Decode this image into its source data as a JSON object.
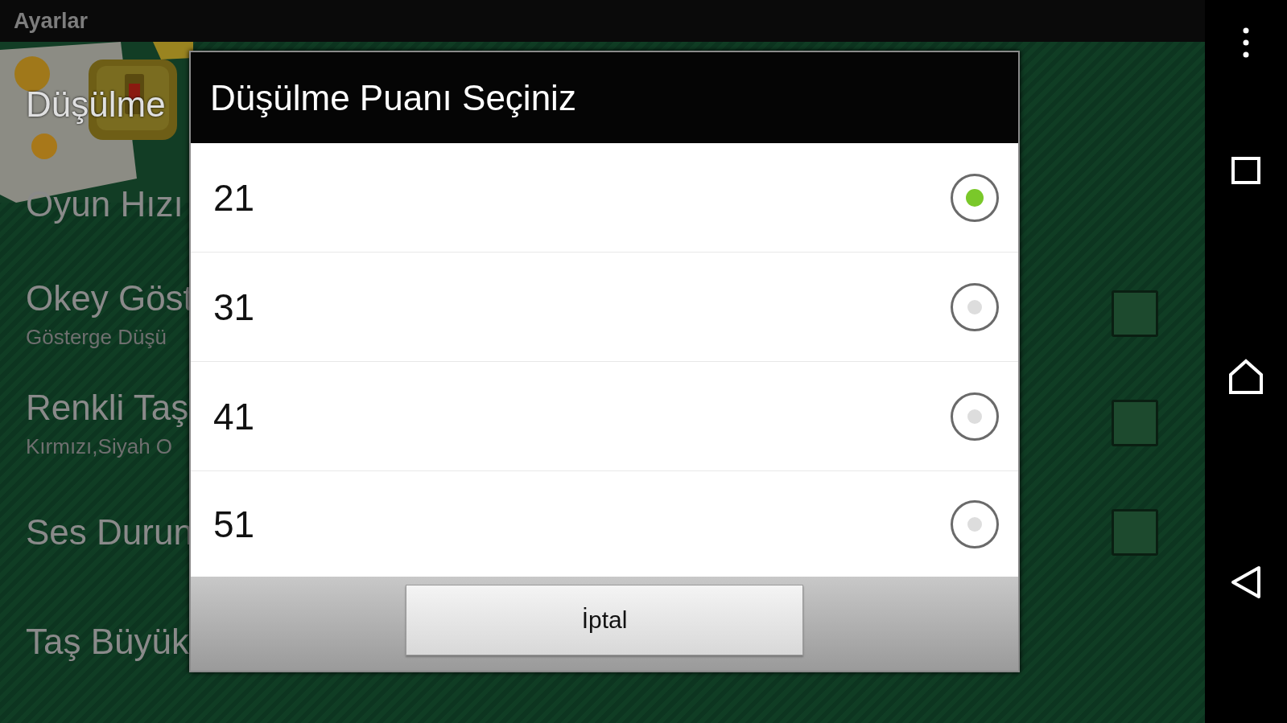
{
  "action_bar": {
    "title": "Ayarlar"
  },
  "settings": [
    {
      "kind": "plain",
      "title": "Düşülme"
    },
    {
      "kind": "plain",
      "title": "Oyun Hızı"
    },
    {
      "kind": "checkbox",
      "title": "Okey Göst",
      "subtitle": "Gösterge Düşü",
      "checked": false
    },
    {
      "kind": "checkbox",
      "title": "Renkli Taş",
      "subtitle": "Kırmızı,Siyah O",
      "checked": false
    },
    {
      "kind": "checkbox",
      "title": "Ses Durun",
      "checked": false
    },
    {
      "kind": "plain",
      "title": "Taş Büyük"
    }
  ],
  "dialog": {
    "title": "Düşülme Puanı Seçiniz",
    "options": [
      {
        "label": "21",
        "selected": true
      },
      {
        "label": "31",
        "selected": false
      },
      {
        "label": "41",
        "selected": false
      },
      {
        "label": "51",
        "selected": false
      }
    ],
    "cancel_button": "İptal"
  }
}
